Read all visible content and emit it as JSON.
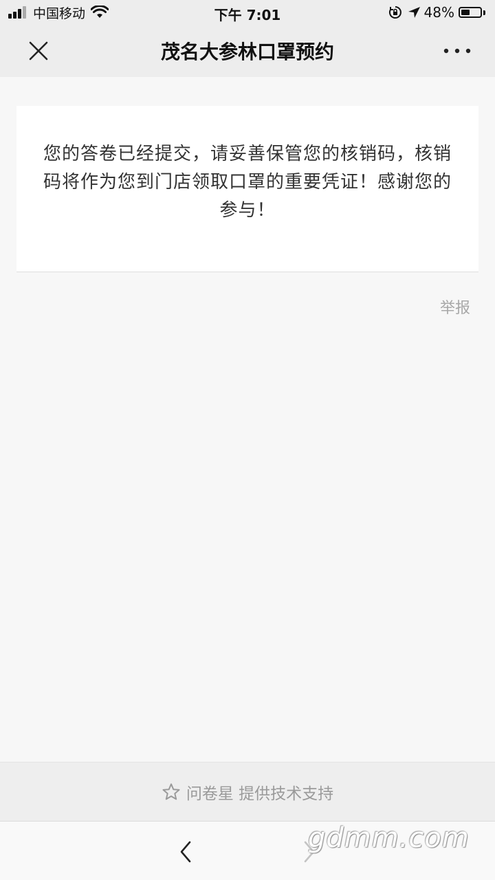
{
  "status_bar": {
    "carrier": "中国移动",
    "time": "下午 7:01",
    "battery_percent": "48%",
    "battery_level": 0.48
  },
  "nav": {
    "title": "茂名大参林口罩预约",
    "close_icon": "close-icon",
    "more_icon": "more-icon"
  },
  "card": {
    "message": "您的答卷已经提交，请妥善保管您的核销码，核销码将作为您到门店领取口罩的重要凭证！感谢您的参与！"
  },
  "report": {
    "label": "举报"
  },
  "footer": {
    "text": "问卷星 提供技术支持",
    "icon": "star-icon"
  },
  "toolbar": {
    "back_icon": "chevron-left-icon",
    "forward_icon": "chevron-right-icon"
  },
  "watermark": {
    "text": "gdmm.com"
  },
  "colors": {
    "bar_bg": "#ededed",
    "page_bg": "#f7f7f7",
    "card_bg": "#ffffff",
    "text": "#333333",
    "muted": "#a8a8a8"
  }
}
